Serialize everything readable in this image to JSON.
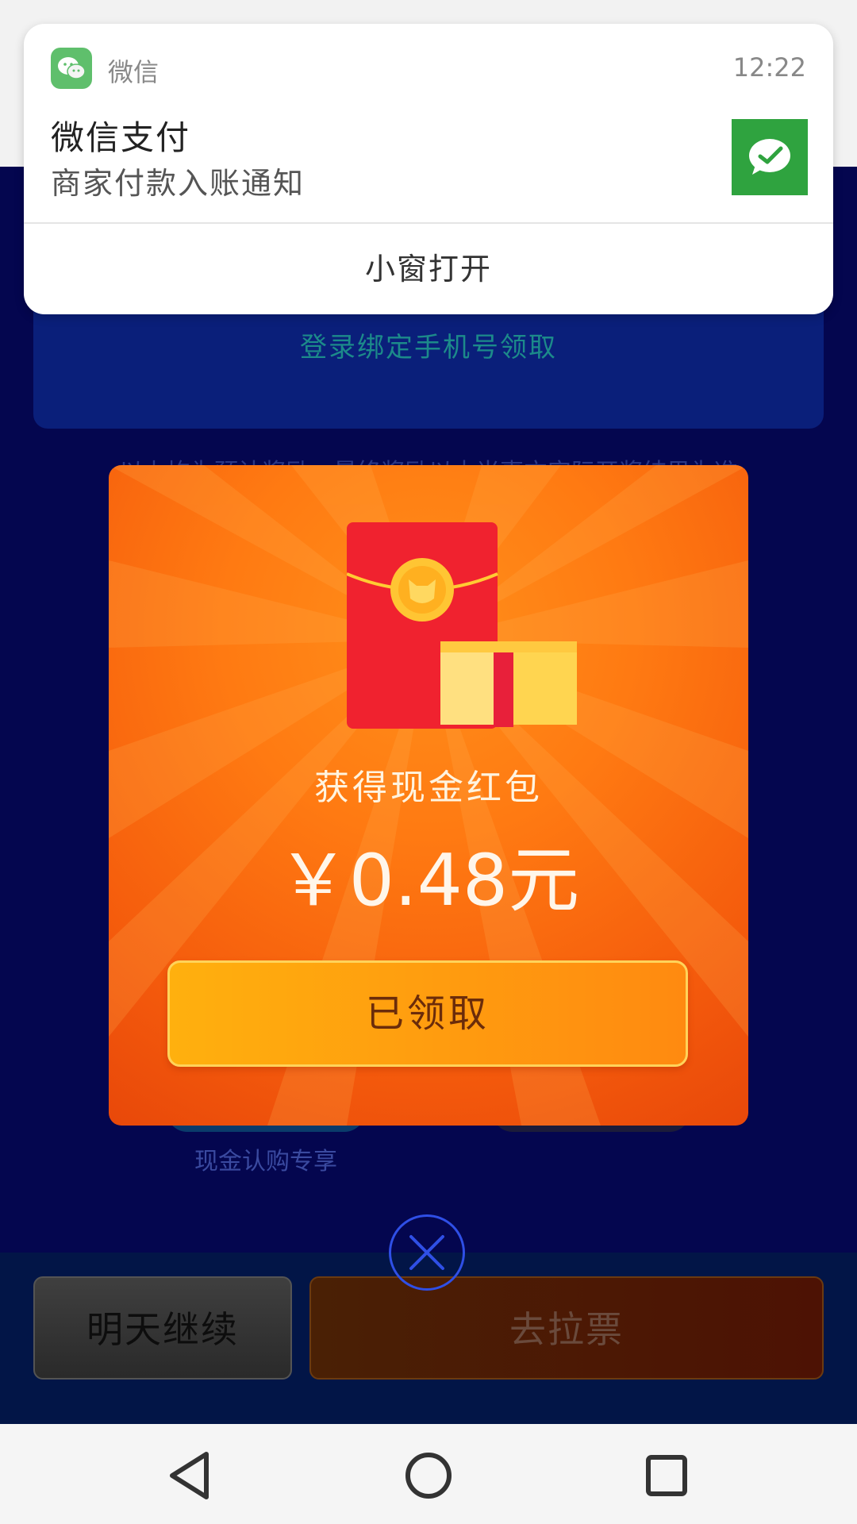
{
  "notification": {
    "app_name": "微信",
    "time": "12:22",
    "title": "微信支付",
    "body": "商家付款入账通知",
    "action_label": "小窗打开"
  },
  "background": {
    "bind_card_text": "登录绑定手机号领取",
    "disclaimer": "以上均为预计奖励，最终奖励以本当事方实际开奖结果为准",
    "cash_label": "现金认购专享",
    "tomorrow_button": "明天继续",
    "vote_button": "去拉票"
  },
  "modal": {
    "title": "获得现金红包",
    "amount": "￥0.48元",
    "claim_button": "已领取"
  },
  "navbar": {
    "icons": [
      "back-icon",
      "home-icon",
      "recents-icon"
    ]
  },
  "colors": {
    "app_background": "#04064f",
    "modal_orange": "#ff7a12",
    "wechat_green": "#2fa33f",
    "close_ring_blue": "#2f4fe6"
  }
}
